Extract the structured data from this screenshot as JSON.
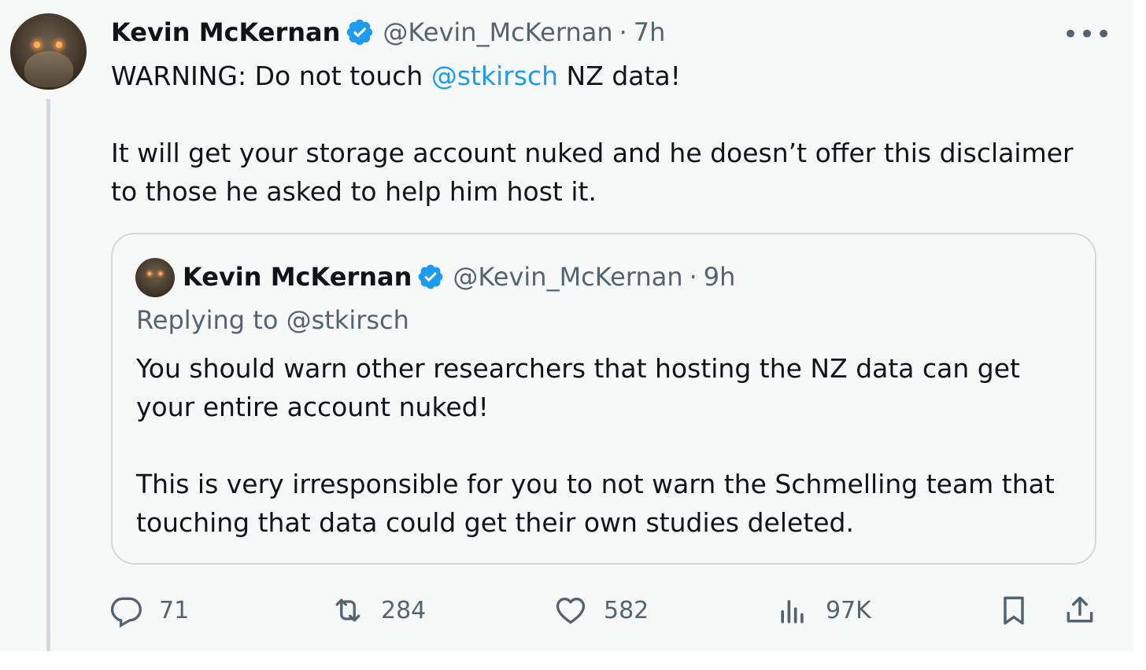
{
  "tweet": {
    "author_name": "Kevin McKernan",
    "author_handle": "@Kevin_McKernan",
    "separator": "·",
    "time": "7h",
    "body_line1_prefix": "WARNING: Do not touch ",
    "body_line1_mention": "@stkirsch",
    "body_line1_suffix": " NZ data!",
    "body_paragraph2": "It will get your storage account nuked and he doesn’t offer this disclaimer to those he asked to help him host it."
  },
  "quote": {
    "author_name": "Kevin McKernan",
    "author_handle": "@Kevin_McKernan",
    "separator": "·",
    "time": "9h",
    "replying_to": "Replying to @stkirsch",
    "paragraph1": "You should warn other researchers that hosting the NZ data can get your entire account nuked!",
    "paragraph2": "This is very irresponsible for you to not warn the Schmelling team that touching that data could get their own studies deleted."
  },
  "actions": {
    "replies": "71",
    "reposts": "284",
    "likes": "582",
    "views": "97K"
  },
  "colors": {
    "accent": "#1d9bf0",
    "secondary_text": "#536471",
    "border": "#cfd9de",
    "background": "#f7f9f9"
  },
  "icons": [
    "avatar",
    "verified-badge-icon",
    "more-icon",
    "reply-icon",
    "repost-icon",
    "like-icon",
    "views-icon",
    "bookmark-icon",
    "share-icon"
  ]
}
